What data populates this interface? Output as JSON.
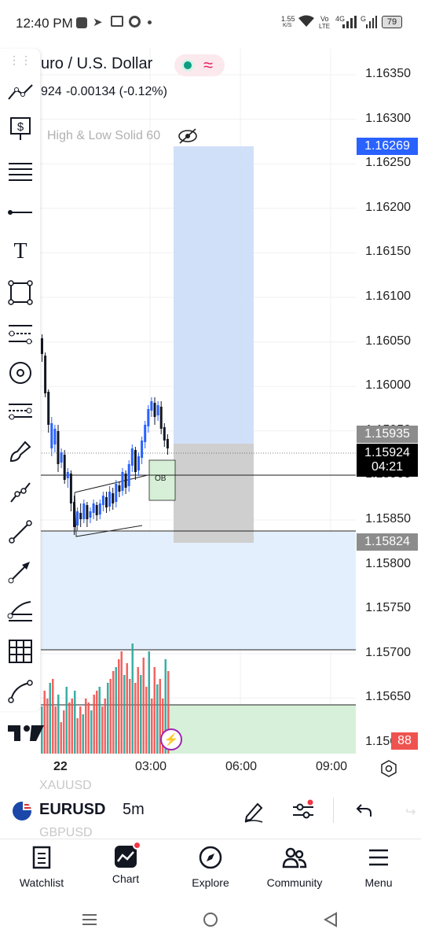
{
  "status_bar": {
    "time": "12:40 PM",
    "net_speed_value": "1.55",
    "net_speed_unit": "K/S",
    "volte_top": "Vo",
    "volte_bottom": "LTE",
    "signal_4g": "4G",
    "signal_g": "G",
    "battery": "79"
  },
  "header": {
    "title": "Euro / U.S. Dollar",
    "title_visible": "uro / U.S. Dollar",
    "change_prefix": "924",
    "change": "-0.00134 (-0.12%)"
  },
  "indicator": {
    "label": "High & Low Solid 60"
  },
  "price_axis": {
    "labels": [
      "1.16350",
      "1.16300",
      "1.16250",
      "1.16200",
      "1.16150",
      "1.16100",
      "1.16050",
      "1.16000",
      "1.15950",
      "1.15900",
      "1.15850",
      "1.15800",
      "1.15750",
      "1.15700",
      "1.15650",
      "1.15600"
    ],
    "tag_target": "1.16269",
    "tag_high": "1.15935",
    "tag_current": "1.15924",
    "tag_countdown": "04:21",
    "tag_low": "1.15824",
    "tag_volume": "88"
  },
  "time_axis": {
    "labels": [
      "22",
      "03:00",
      "06:00",
      "09:00"
    ]
  },
  "annotations": {
    "ob": "OB"
  },
  "symbol_bar": {
    "prev_symbol": "XAUUSD",
    "symbol": "EURUSD",
    "next_symbol": "GBPUSD",
    "interval": "5m"
  },
  "bottom_nav": {
    "items": [
      {
        "label": "Watchlist"
      },
      {
        "label": "Chart"
      },
      {
        "label": "Explore"
      },
      {
        "label": "Community"
      },
      {
        "label": "Menu"
      }
    ]
  },
  "chart_data": {
    "type": "candlestick",
    "symbol": "EURUSD",
    "interval": "5m",
    "ylim": [
      1.1559,
      1.1639
    ],
    "x_ticks": [
      "22",
      "03:00",
      "06:00",
      "09:00"
    ],
    "current_price": 1.15924,
    "long_position": {
      "entry": 1.15935,
      "target": 1.16269,
      "stop": 1.15824
    },
    "horizontal_lines": [
      1.159,
      1.15833,
      1.15702,
      1.15641
    ],
    "colors": {
      "up": "#2962ff",
      "down": "#131722",
      "vol_up": "#26a69a",
      "vol_down": "#ef5350"
    }
  }
}
